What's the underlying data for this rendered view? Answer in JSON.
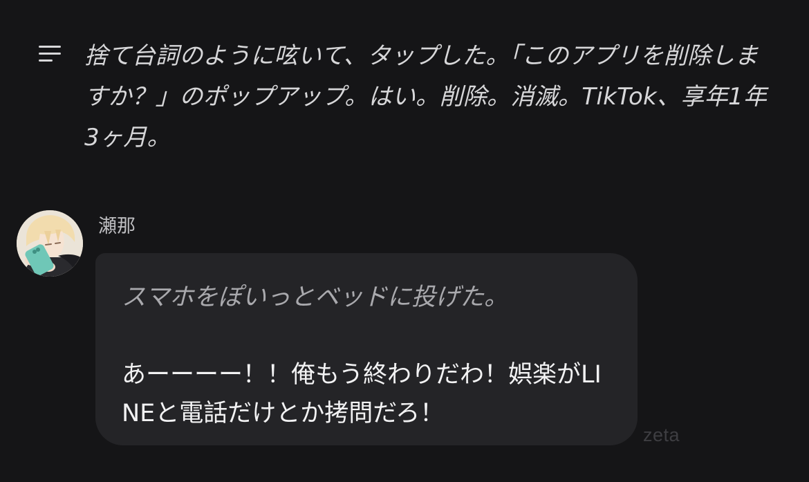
{
  "narration": {
    "icon": "notes-lines-icon",
    "text": "捨て台詞のように呟いて、タップした。「このアプリを削除しますか？」のポップアップ。はい。削除。消滅。TikTok、享年1年3ヶ月。"
  },
  "message": {
    "character_name": "瀬那",
    "avatar_icon": "character-avatar",
    "action_text": "スマホをぽいっとベッドに投げた。",
    "speech_text": "あーーーー！！俺もう終わりだわ！娯楽がLINEと電話だけとか拷問だろ！"
  },
  "watermark": "zeta",
  "colors": {
    "background": "#151517",
    "bubble": "#242427",
    "speech_text": "#f2f2f3",
    "action_text": "#a9a9ad"
  }
}
